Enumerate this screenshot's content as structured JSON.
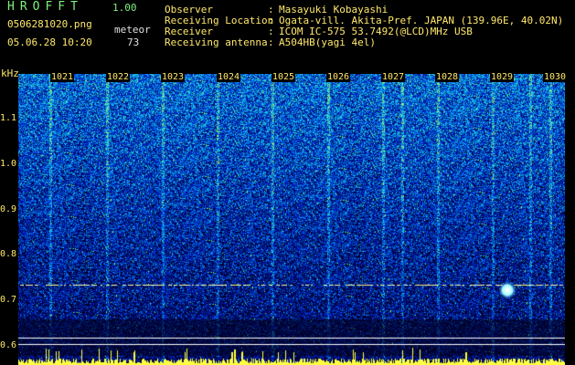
{
  "header": {
    "app_title": "HROFFT",
    "app_version": "1.00",
    "file_name": "0506281020.png",
    "mode": "meteor",
    "datetime": "05.06.28 10:20",
    "meteor_count": "73"
  },
  "station": {
    "observer_label": "Observer",
    "observer": "Masayuki Kobayashi",
    "location_label": "Receiving Location",
    "location": "Ogata-vill. Akita-Pref. JAPAN (139.96E, 40.02N)",
    "receiver_label": "Receiver",
    "receiver": "ICOM IC-575 53.7492(@LCD)MHz USB",
    "antenna_label": "Receiving antenna",
    "antenna": "A504HB(yagi 4el)"
  },
  "spectrogram": {
    "unit": "kHz",
    "y_ticks": [
      "1.1",
      "1.0",
      "0.9",
      "0.8",
      "0.7",
      "0.6"
    ],
    "x_ticks": [
      "1021",
      "1022",
      "1023",
      "1024",
      "1025",
      "1026",
      "1027",
      "1028",
      "1029",
      "1030"
    ],
    "colors": {
      "label": "#ffe86b",
      "title": "#7df07d",
      "trace": "#ffffa0"
    }
  }
}
